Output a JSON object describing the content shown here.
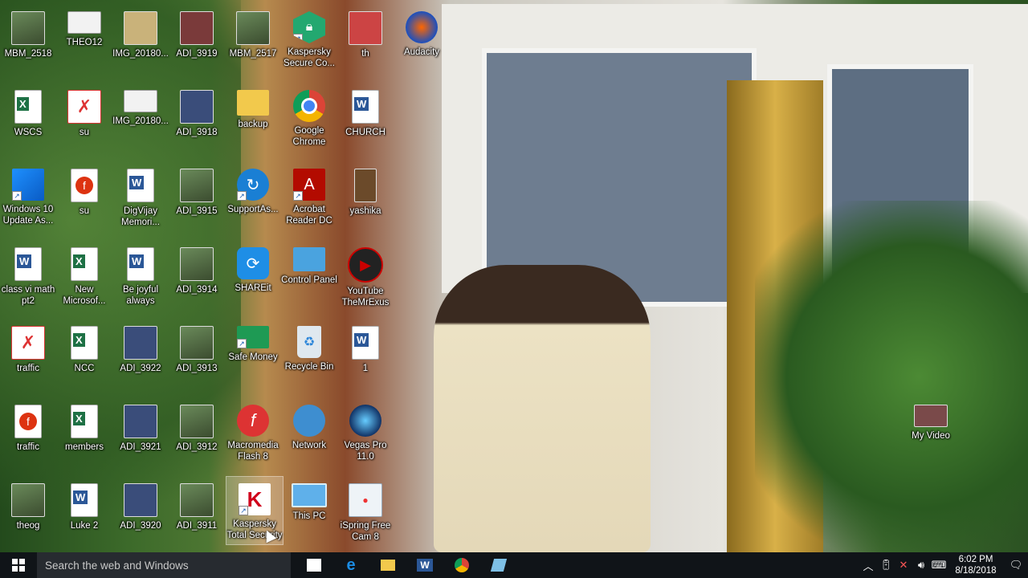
{
  "desktop": {
    "icons": [
      {
        "label": "MBM_2518"
      },
      {
        "label": "THEO12"
      },
      {
        "label": "IMG_20180..."
      },
      {
        "label": "ADI_3919"
      },
      {
        "label": "MBM_2517"
      },
      {
        "label": "Kaspersky Secure Co..."
      },
      {
        "label": "th"
      },
      {
        "label": "Audacity"
      },
      {
        "label": "WSCS"
      },
      {
        "label": "su"
      },
      {
        "label": "IMG_20180..."
      },
      {
        "label": "ADI_3918"
      },
      {
        "label": "backup"
      },
      {
        "label": "Google Chrome"
      },
      {
        "label": "CHURCH"
      },
      {
        "label": "Windows 10 Update As..."
      },
      {
        "label": "su"
      },
      {
        "label": "DigVijay Memori..."
      },
      {
        "label": "ADI_3915"
      },
      {
        "label": "SupportAs..."
      },
      {
        "label": "Acrobat Reader DC"
      },
      {
        "label": "yashika"
      },
      {
        "label": "class vi math pt2"
      },
      {
        "label": "New Microsof..."
      },
      {
        "label": "Be joyful always"
      },
      {
        "label": "ADI_3914"
      },
      {
        "label": "SHAREit"
      },
      {
        "label": "Control Panel"
      },
      {
        "label": "YouTube TheMrExus"
      },
      {
        "label": "traffic"
      },
      {
        "label": "NCC"
      },
      {
        "label": "ADI_3922"
      },
      {
        "label": "ADI_3913"
      },
      {
        "label": "Safe Money"
      },
      {
        "label": "Recycle Bin"
      },
      {
        "label": "1"
      },
      {
        "label": "traffic"
      },
      {
        "label": "members"
      },
      {
        "label": "ADI_3921"
      },
      {
        "label": "ADI_3912"
      },
      {
        "label": "Macromedia Flash 8"
      },
      {
        "label": "Network"
      },
      {
        "label": "Vegas Pro 11.0"
      },
      {
        "label": "theog"
      },
      {
        "label": "Luke 2"
      },
      {
        "label": "ADI_3920"
      },
      {
        "label": "ADI_3911"
      },
      {
        "label": "Kaspersky Total Security"
      },
      {
        "label": "This PC"
      },
      {
        "label": "iSpring Free Cam 8"
      },
      {
        "label": "My Video"
      }
    ]
  },
  "taskbar": {
    "search_placeholder": "Search the web and Windows",
    "time": "6:02 PM",
    "date": "8/18/2018"
  },
  "colors": {
    "taskbar": "#101418",
    "search": "#272b30",
    "selection": "#ffffff"
  }
}
